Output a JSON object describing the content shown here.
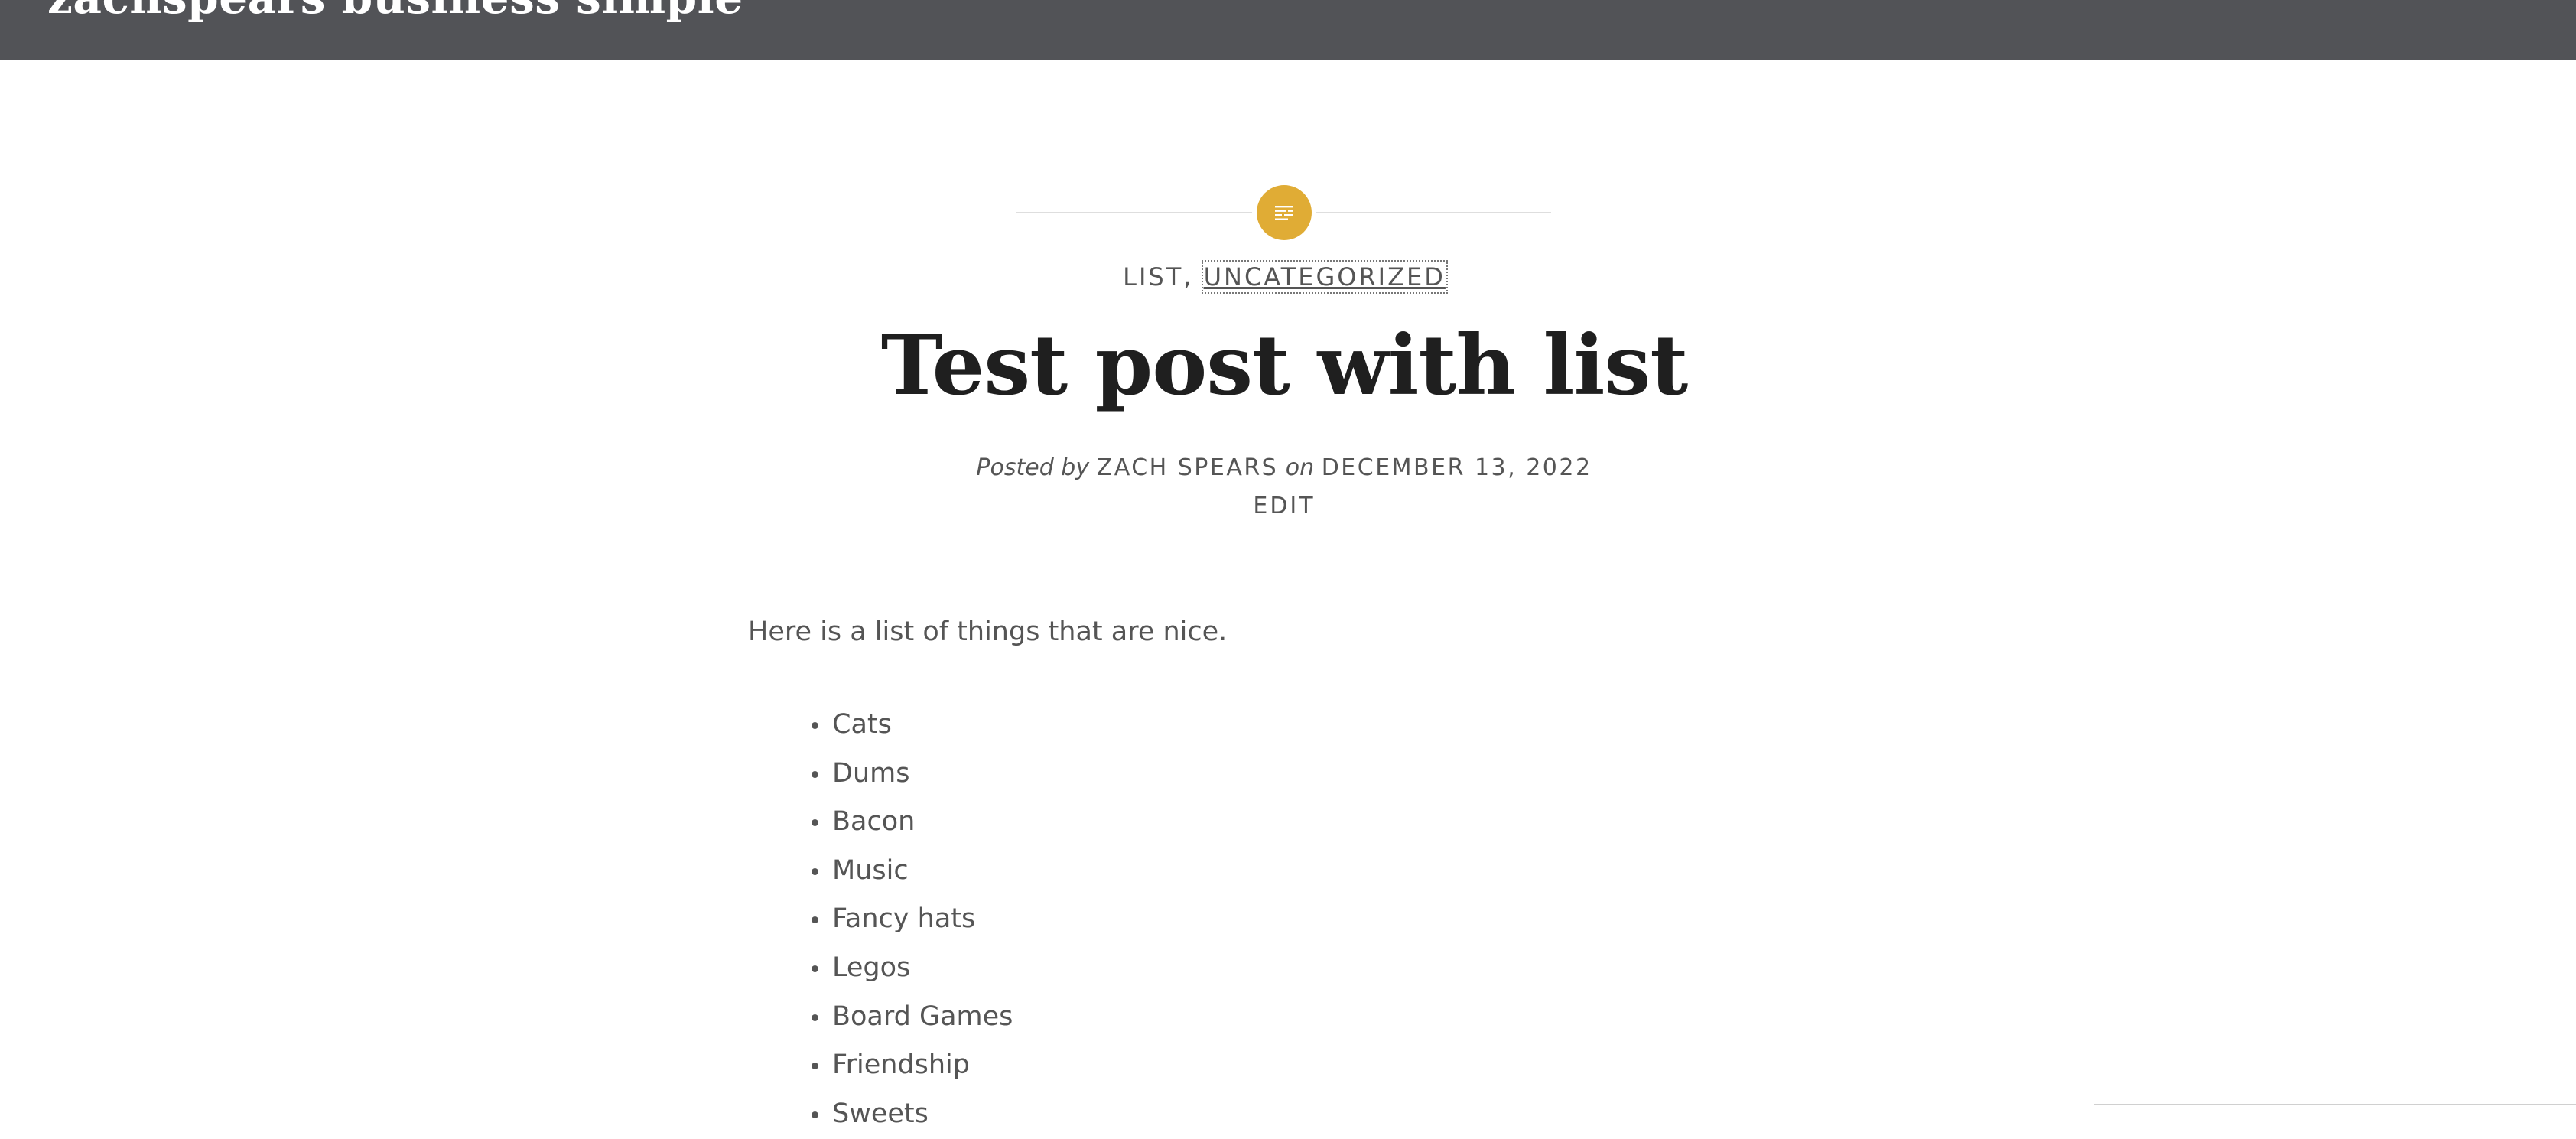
{
  "header": {
    "site_title": "zachspears business simple"
  },
  "post": {
    "categories": [
      {
        "label": "LIST",
        "separator": ", "
      },
      {
        "label": "UNCATEGORIZED",
        "separator": ""
      }
    ],
    "title": "Test post with list",
    "byline": {
      "posted_by_prefix": "Posted by",
      "author": "ZACH SPEARS",
      "on_word": "on",
      "date": "DECEMBER 13, 2022"
    },
    "edit_label": "EDIT",
    "intro": "Here is a list of things that are nice.",
    "list_items": [
      "Cats",
      "Dums",
      "Bacon",
      "Music",
      "Fancy hats",
      "Legos",
      "Board Games",
      "Friendship",
      "Sweets"
    ]
  },
  "icons": {
    "format_badge": "text-align-icon"
  },
  "colors": {
    "header_bg": "#525357",
    "accent": "#e0ac35",
    "title_text": "#1f1f1f",
    "body_text": "#555555"
  }
}
